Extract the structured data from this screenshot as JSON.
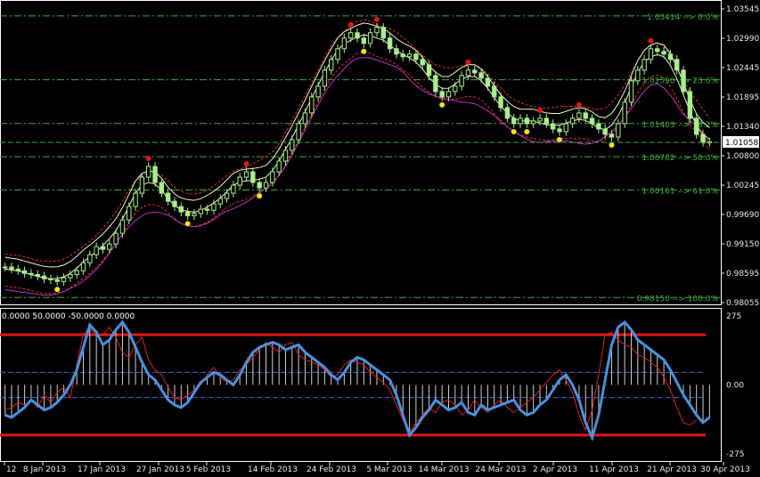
{
  "chart_data": [
    {
      "type": "candlestick",
      "price_ticks": [
        "1.03545",
        "1.02990",
        "1.02445",
        "1.01895",
        "1.01340",
        "1.00800",
        "1.00245",
        "0.99690",
        "0.99150",
        "0.98595",
        "0.98055"
      ],
      "ylim": [
        0.98055,
        1.03545
      ],
      "current_price": "1.01058",
      "fib_levels": [
        {
          "label": "1.03414 --> 0.0%",
          "value": 1.03414
        },
        {
          "label": "1.02590 --> 23.6%",
          "value": 1.0222
        },
        {
          "label": "1.01403 --> 38.2%",
          "value": 1.01403
        },
        {
          "label": "1.00782 --> 50.0%",
          "value": 1.00782
        },
        {
          "label": "1.00161 --> 61.8%",
          "value": 1.00161
        },
        {
          "label": "0.98150 --> 100.0%",
          "value": 0.9815
        }
      ],
      "x_labels": [
        "12",
        "8 Jan 2013",
        "17 Jan 2013",
        "27 Jan 2013",
        "5 Feb 2013",
        "14 Feb 2013",
        "24 Feb 2013",
        "5 Mar 2013",
        "14 Mar 2013",
        "24 Mar 2013",
        "2 Apr 2013",
        "11 Apr 2013",
        "21 Apr 2013",
        "30 Apr 2013"
      ],
      "close": [
        0.9872,
        0.9868,
        0.9865,
        0.986,
        0.9858,
        0.9855,
        0.985,
        0.9848,
        0.9845,
        0.9852,
        0.9858,
        0.9865,
        0.988,
        0.9895,
        0.991,
        0.9905,
        0.9915,
        0.9935,
        0.996,
        0.9985,
        1.001,
        1.004,
        1.006,
        1.003,
        1.001,
        0.9995,
        0.9985,
        0.9975,
        0.9968,
        0.9972,
        0.998,
        0.9978,
        0.999,
        1.0,
        1.001,
        1.0025,
        1.004,
        1.005,
        1.003,
        1.002,
        1.003,
        1.005,
        1.007,
        1.009,
        1.011,
        1.014,
        1.016,
        1.019,
        1.021,
        1.024,
        1.026,
        1.028,
        1.03,
        1.031,
        1.03,
        1.029,
        1.031,
        1.032,
        1.03,
        1.028,
        1.027,
        1.0265,
        1.027,
        1.026,
        1.025,
        1.023,
        1.02,
        1.019,
        1.02,
        1.021,
        1.023,
        1.024,
        1.0235,
        1.0225,
        1.021,
        1.019,
        1.017,
        1.015,
        1.014,
        1.015,
        1.014,
        1.0145,
        1.015,
        1.014,
        1.013,
        1.0125,
        1.014,
        1.015,
        1.016,
        1.015,
        1.014,
        1.013,
        1.012,
        1.0115,
        1.014,
        1.018,
        1.022,
        1.024,
        1.026,
        1.028,
        1.0275,
        1.027,
        1.026,
        1.024,
        1.02,
        1.015,
        1.012,
        1.0105,
        1.0106
      ],
      "ma_color": "#f2f2c8",
      "envelope_color": "#e03030",
      "lower_band_color": "#c030c0",
      "candle_color": "#a8f08a",
      "dot_red": "#e01818",
      "dot_yellow": "#f2e21a",
      "fib_color": "#3fae3f"
    },
    {
      "type": "line",
      "header": "0.0000 50.0000 -50.0000 0.0000",
      "ylim": [
        -275,
        275
      ],
      "y_ticks": [
        "275",
        "0.00",
        "-275"
      ],
      "levels": [
        200,
        50,
        -50,
        -200
      ],
      "cci": [
        -120,
        -130,
        -110,
        -90,
        -60,
        -80,
        -100,
        -90,
        -70,
        -40,
        0,
        60,
        150,
        240,
        210,
        160,
        180,
        220,
        250,
        210,
        150,
        90,
        40,
        20,
        -20,
        -60,
        -80,
        -90,
        -70,
        -30,
        10,
        30,
        50,
        40,
        20,
        0,
        40,
        90,
        130,
        150,
        160,
        170,
        160,
        140,
        150,
        160,
        130,
        110,
        90,
        70,
        40,
        20,
        50,
        90,
        110,
        100,
        80,
        60,
        40,
        20,
        -40,
        -120,
        -200,
        -170,
        -130,
        -100,
        -60,
        -80,
        -100,
        -90,
        -70,
        -110,
        -120,
        -80,
        -100,
        -90,
        -80,
        -70,
        -60,
        -100,
        -120,
        -110,
        -80,
        -60,
        -20,
        20,
        40,
        0,
        -60,
        -150,
        -210,
        -120,
        20,
        160,
        230,
        250,
        220,
        180,
        160,
        140,
        120,
        100,
        60,
        10,
        -40,
        -80,
        -120,
        -150,
        -130
      ],
      "signal": [
        -100,
        -90,
        -70,
        -80,
        -60,
        -90,
        -40,
        -70,
        -30,
        -10,
        -50,
        80,
        200,
        230,
        190,
        200,
        230,
        190,
        130,
        110,
        160,
        190,
        100,
        60,
        40,
        -10,
        -50,
        -60,
        -40,
        -20,
        0,
        40,
        70,
        30,
        10,
        20,
        60,
        80,
        110,
        140,
        170,
        150,
        130,
        160,
        170,
        120,
        100,
        90,
        80,
        60,
        30,
        40,
        80,
        100,
        90,
        80,
        50,
        30,
        10,
        -20,
        -80,
        -140,
        -190,
        -150,
        -120,
        -90,
        -110,
        -70,
        -60,
        -80,
        -120,
        -100,
        -60,
        -90,
        -110,
        -80,
        -60,
        -90,
        -110,
        -90,
        -70,
        -50,
        -20,
        10,
        40,
        60,
        20,
        -30,
        -120,
        -180,
        -100,
        40,
        200,
        210,
        180,
        160,
        150,
        120,
        110,
        90,
        70,
        30,
        -20,
        -90,
        -150,
        -160,
        -140
      ],
      "cci_color": "#4a90e0",
      "signal_color": "#e02020",
      "extreme_color": "#e01818",
      "mid_color": "#3a6ad8"
    }
  ]
}
